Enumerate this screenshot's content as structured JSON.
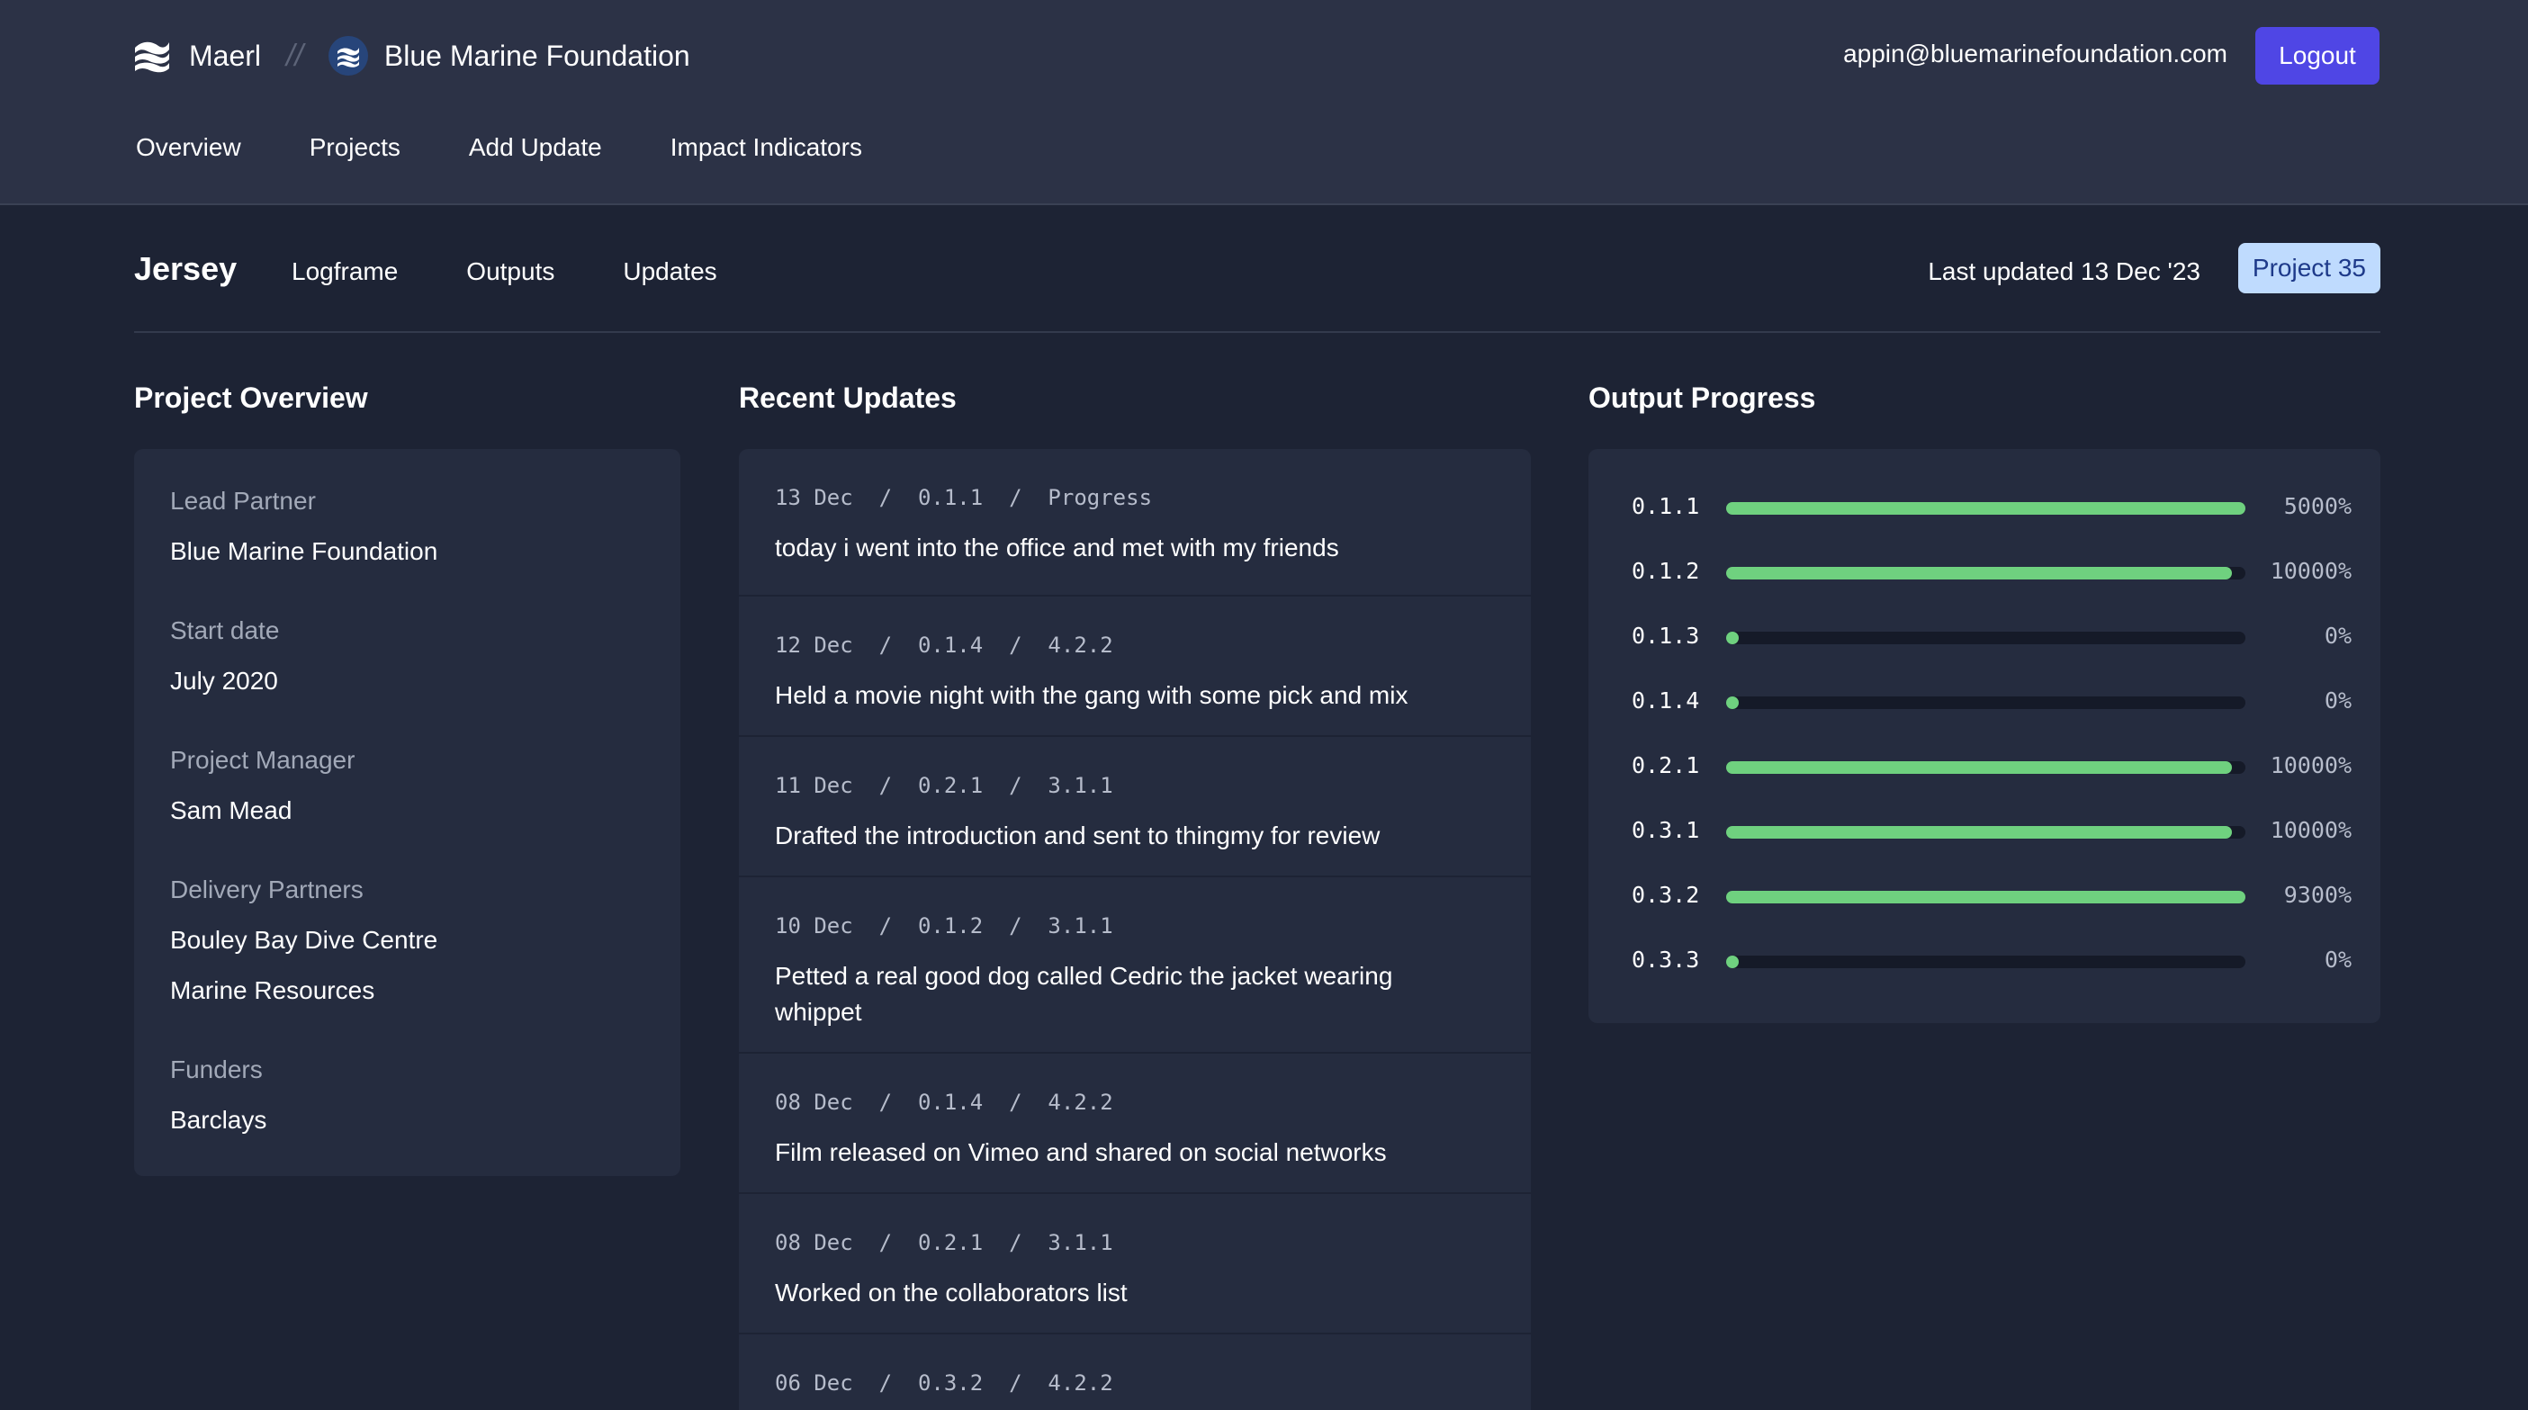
{
  "header": {
    "app_name": "Maerl",
    "separator": "//",
    "org_name": "Blue Marine Foundation",
    "user_email": "appin@bluemarinefoundation.com",
    "logout_label": "Logout",
    "nav": [
      "Overview",
      "Projects",
      "Add Update",
      "Impact Indicators"
    ]
  },
  "project": {
    "name": "Jersey",
    "tabs": [
      "Logframe",
      "Outputs",
      "Updates"
    ],
    "last_updated": "Last updated 13 Dec '23",
    "badge": "Project 35"
  },
  "overview": {
    "title": "Project Overview",
    "lead_partner_label": "Lead Partner",
    "lead_partner": "Blue Marine Foundation",
    "start_date_label": "Start date",
    "start_date": "July 2020",
    "manager_label": "Project Manager",
    "manager": "Sam Mead",
    "delivery_partners_label": "Delivery Partners",
    "delivery_partners": [
      "Bouley Bay Dive Centre",
      "Marine Resources"
    ],
    "funders_label": "Funders",
    "funders": [
      "Barclays"
    ]
  },
  "updates": {
    "title": "Recent Updates",
    "items": [
      {
        "meta": "13 Dec  /  0.1.1  /  Progress",
        "text": "today i went into the office and met with my friends"
      },
      {
        "meta": "12 Dec  /  0.1.4  /  4.2.2",
        "text": "Held a movie night with the gang with some pick and mix"
      },
      {
        "meta": "11 Dec  /  0.2.1  /  3.1.1",
        "text": "Drafted the introduction and sent to thingmy for review"
      },
      {
        "meta": "10 Dec  /  0.1.2  /  3.1.1",
        "text": "Petted a real good dog called Cedric the jacket wearing whippet"
      },
      {
        "meta": "08 Dec  /  0.1.4  /  4.2.2",
        "text": "Film released on Vimeo and shared on social networks"
      },
      {
        "meta": "08 Dec  /  0.2.1  /  3.1.1",
        "text": "Worked on the collaborators list"
      },
      {
        "meta": "06 Dec  /  0.3.2  /  4.2.2",
        "text": ""
      }
    ]
  },
  "progress": {
    "title": "Output Progress",
    "accent_color": "#6fd17f",
    "rows": [
      {
        "code": "0.1.1",
        "pct": "5000%",
        "fill": 1.0
      },
      {
        "code": "0.1.2",
        "pct": "10000%",
        "fill": 1.0
      },
      {
        "code": "0.1.3",
        "pct": "0%",
        "fill": 0
      },
      {
        "code": "0.1.4",
        "pct": "0%",
        "fill": 0
      },
      {
        "code": "0.2.1",
        "pct": "10000%",
        "fill": 1.0
      },
      {
        "code": "0.3.1",
        "pct": "10000%",
        "fill": 1.0
      },
      {
        "code": "0.3.2",
        "pct": "9300%",
        "fill": 1.0
      },
      {
        "code": "0.3.3",
        "pct": "0%",
        "fill": 0
      }
    ]
  }
}
